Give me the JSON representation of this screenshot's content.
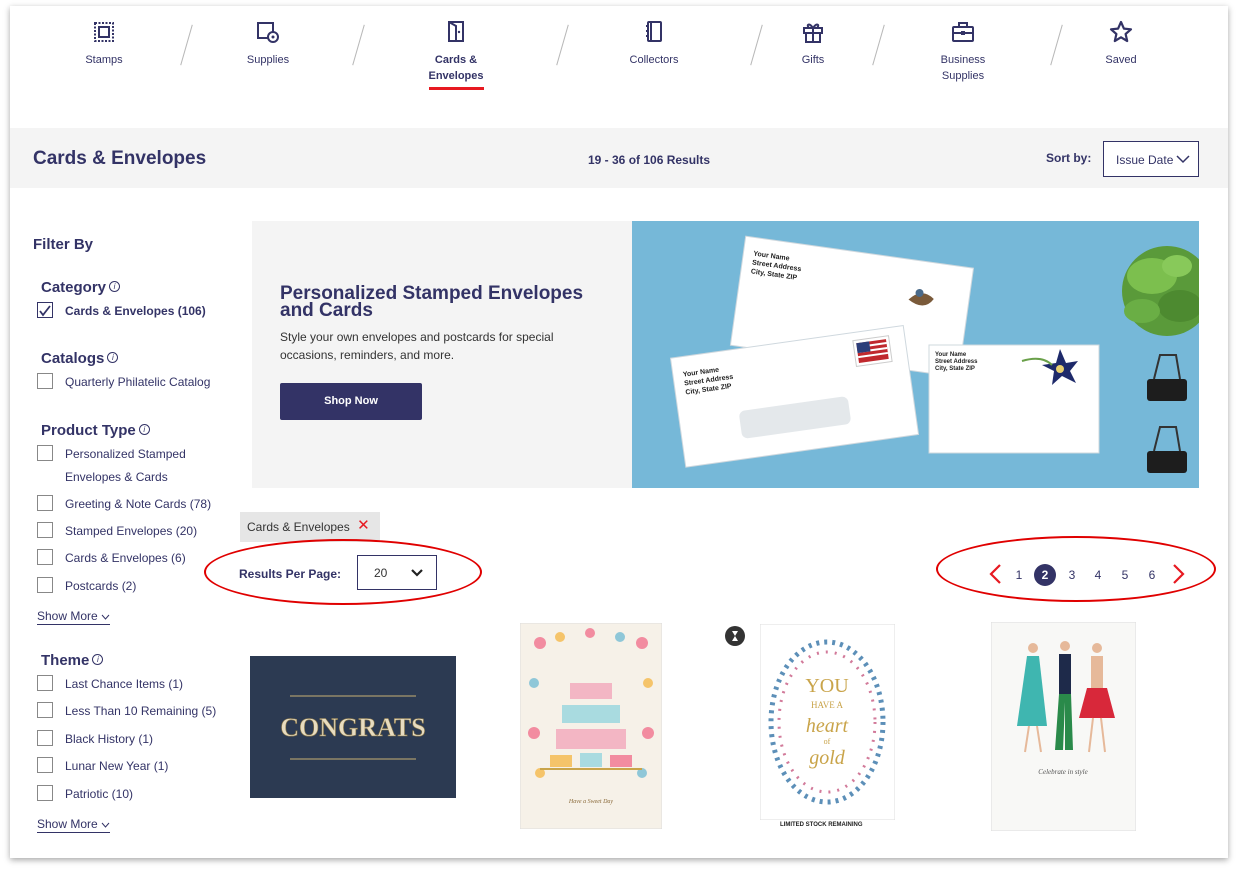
{
  "nav": {
    "items": [
      {
        "label_line1": "Stamps",
        "label_line2": "",
        "icon": "stamp-icon"
      },
      {
        "label_line1": "Supplies",
        "label_line2": "",
        "icon": "supplies-icon"
      },
      {
        "label_line1": "Cards &",
        "label_line2": "Envelopes",
        "icon": "card-icon",
        "active": true
      },
      {
        "label_line1": "Collectors",
        "label_line2": "",
        "icon": "book-icon"
      },
      {
        "label_line1": "Gifts",
        "label_line2": "",
        "icon": "gift-icon"
      },
      {
        "label_line1": "Business",
        "label_line2": "Supplies",
        "icon": "briefcase-icon"
      },
      {
        "label_line1": "Saved",
        "label_line2": "",
        "icon": "star-icon"
      }
    ]
  },
  "pagebar": {
    "title": "Cards & Envelopes",
    "results": "19 - 36 of 106 Results",
    "sort_label": "Sort by:",
    "sort_value": "Issue Date"
  },
  "sidebar": {
    "filter_by": "Filter By",
    "category": {
      "title": "Category",
      "options": [
        {
          "label": "Cards & Envelopes (106)",
          "checked": true
        }
      ]
    },
    "catalogs": {
      "title": "Catalogs",
      "options": [
        {
          "label": "Quarterly Philatelic Catalog",
          "checked": false
        }
      ]
    },
    "product_type": {
      "title": "Product Type",
      "options": [
        {
          "label": "Personalized Stamped Envelopes & Cards",
          "checked": false
        },
        {
          "label": "Greeting & Note Cards (78)",
          "checked": false
        },
        {
          "label": "Stamped Envelopes (20)",
          "checked": false
        },
        {
          "label": "Cards & Envelopes (6)",
          "checked": false
        },
        {
          "label": "Postcards (2)",
          "checked": false
        }
      ],
      "show_more": "Show More"
    },
    "theme": {
      "title": "Theme",
      "options": [
        {
          "label": "Last Chance Items (1)",
          "checked": false
        },
        {
          "label": "Less Than 10 Remaining (5)",
          "checked": false
        },
        {
          "label": "Black History (1)",
          "checked": false
        },
        {
          "label": "Lunar New Year (1)",
          "checked": false
        },
        {
          "label": "Patriotic (10)",
          "checked": false
        }
      ],
      "show_more": "Show More"
    }
  },
  "banner": {
    "title": "Personalized Stamped Envelopes and Cards",
    "text": "Style your own envelopes and postcards for special occasions, reminders, and more.",
    "button": "Shop Now",
    "envelope_name": "Your Name",
    "envelope_street": "Street Address",
    "envelope_city": "City, State ZIP"
  },
  "active_filter": {
    "label": "Cards & Envelopes",
    "remove": "✕"
  },
  "results_per_page": {
    "label": "Results Per Page:",
    "value": "20"
  },
  "pagination": {
    "pages": [
      "1",
      "2",
      "3",
      "4",
      "5",
      "6"
    ],
    "current": "2"
  },
  "products": [
    {
      "name": "congrats-card",
      "text": "CONGRATS"
    },
    {
      "name": "sweet-day-card",
      "text": "Have a Sweet Day"
    },
    {
      "name": "heart-of-gold-card",
      "text_lines": [
        "YOU",
        "HAVE A",
        "heart",
        "of",
        "gold"
      ],
      "badge": "LIMITED STOCK REMAINING"
    },
    {
      "name": "celebrate-card",
      "text": "Celebrate in style"
    }
  ],
  "colors": {
    "brand": "#333366",
    "accent": "#e71921",
    "annotation": "#e00000",
    "banner_blue": "#76b8d8"
  }
}
